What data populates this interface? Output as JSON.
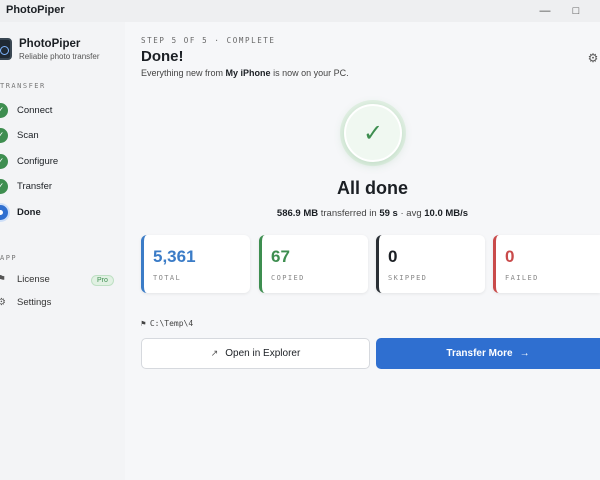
{
  "window": {
    "title": "PhotoPiper"
  },
  "brand": {
    "name": "PhotoPiper",
    "tagline": "Reliable photo transfer"
  },
  "sidebar": {
    "transfer_section": "TRANSFER",
    "steps": [
      {
        "label": "Connect",
        "state": "done"
      },
      {
        "label": "Scan",
        "state": "done"
      },
      {
        "label": "Configure",
        "state": "done"
      },
      {
        "label": "Transfer",
        "state": "done"
      },
      {
        "label": "Done",
        "state": "current"
      }
    ],
    "app_section": "APP",
    "app_items": [
      {
        "label": "License",
        "icon": "key-icon",
        "badge": "Pro"
      },
      {
        "label": "Settings",
        "icon": "gear-icon"
      }
    ]
  },
  "main": {
    "step_label": "STEP 5 OF 5 · COMPLETE",
    "title": "Done!",
    "subtitle_pre": "Everything new from ",
    "subtitle_device": "My iPhone",
    "subtitle_post": " is now on your PC.",
    "hero_title": "All done",
    "stats": {
      "size": "586.9 MB",
      "transferred_text": " transferred in ",
      "duration": "59 s",
      "avg_text": " · avg ",
      "speed": "10.0 MB/s"
    },
    "cards": [
      {
        "value": "5,361",
        "caption": "TOTAL",
        "color": "#3b7cc7"
      },
      {
        "value": "67",
        "caption": "COPIED",
        "color": "#3e8e50"
      },
      {
        "value": "0",
        "caption": "SKIPPED",
        "color": "#2a2f35"
      },
      {
        "value": "0",
        "caption": "FAILED",
        "color": "#c94a4a"
      }
    ],
    "dest_path": "C:\\Temp\\4",
    "open_explorer_label": "Open in Explorer",
    "transfer_more_label": "Transfer More"
  },
  "colors": {
    "accent": "#2f6fd0",
    "success": "#3e8e50",
    "danger": "#c94a4a"
  }
}
